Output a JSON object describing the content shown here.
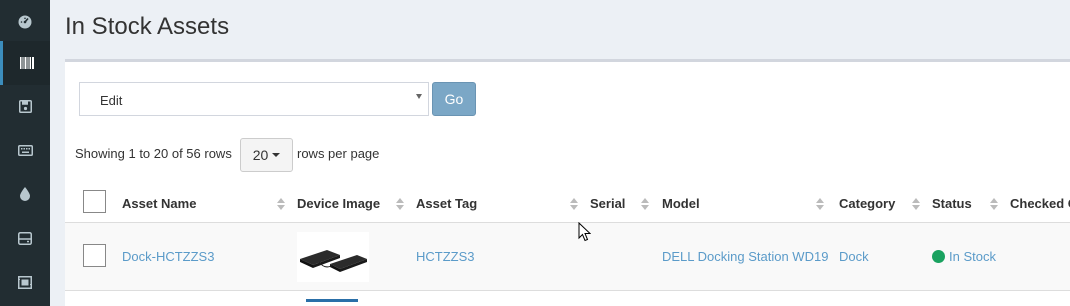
{
  "sidebar": {
    "items": [
      {
        "icon": "dashboard-icon"
      },
      {
        "icon": "barcode-icon",
        "active": true
      },
      {
        "icon": "save-icon"
      },
      {
        "icon": "keyboard-icon"
      },
      {
        "icon": "tint-icon"
      },
      {
        "icon": "hdd-icon"
      },
      {
        "icon": "components-icon"
      }
    ]
  },
  "page": {
    "title": "In Stock Assets"
  },
  "bulk_actions": {
    "selected": "Edit",
    "go_label": "Go"
  },
  "pagination": {
    "info": "Showing 1 to 20 of 56 rows",
    "page_size": "20",
    "rows_per_page_label": "rows per page"
  },
  "table": {
    "columns": [
      "Asset Name",
      "Device Image",
      "Asset Tag",
      "Serial",
      "Model",
      "Category",
      "Status",
      "Checked O"
    ],
    "rows": [
      {
        "asset_name": "Dock-HCTZZS3",
        "asset_tag": "HCTZZS3",
        "serial": "",
        "model": "DELL Docking Station WD19",
        "category": "Dock",
        "status": "In Stock"
      }
    ]
  },
  "colors": {
    "sidebar": "#222d32",
    "link": "#5b9bc9",
    "status_green": "#1aa260",
    "go_button": "#7ba7c6"
  }
}
